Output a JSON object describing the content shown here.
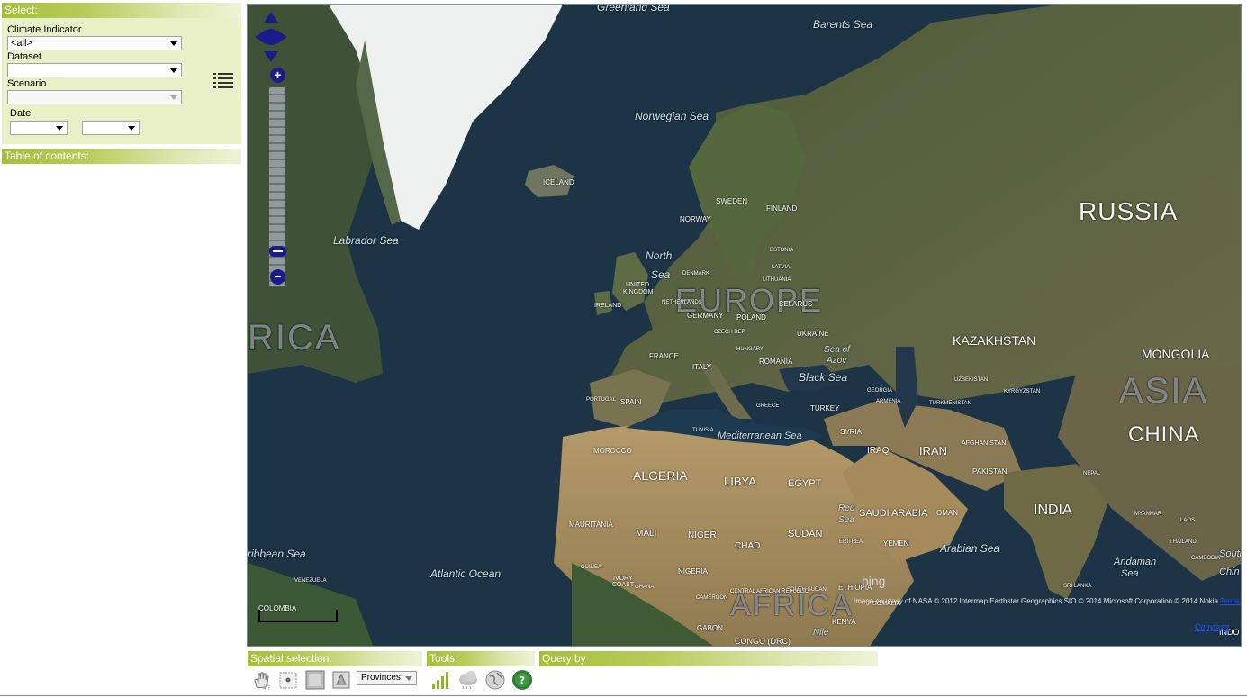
{
  "select_panel": {
    "title": "Select:",
    "climate_indicator_label": "Climate Indicator",
    "climate_indicator_value": "<all>",
    "dataset_label": "Dataset",
    "dataset_value": "",
    "scenario_label": "Scenario",
    "scenario_value": "",
    "date_label": "Date",
    "date_from_value": "",
    "date_to_value": ""
  },
  "toc": {
    "title": "Table of contents:"
  },
  "map": {
    "labels": {
      "greenland_sea": "Greenland Sea",
      "barents_sea": "Barents Sea",
      "norwegian_sea": "Norwegian Sea",
      "iceland": "ICELAND",
      "labrador_sea": "Labrador Sea",
      "north_sea_1": "North",
      "north_sea_2": "Sea",
      "sweden": "SWEDEN",
      "finland": "FINLAND",
      "norway": "NORWAY",
      "denmark": "DENMARK",
      "united_kingdom_1": "UNITED",
      "united_kingdom_2": "KINGDOM",
      "ireland": "IRELAND",
      "europe": "EUROPE",
      "germany": "GERMANY",
      "poland": "POLAND",
      "belarus": "BELARUS",
      "ukraine": "UKRAINE",
      "france": "FRANCE",
      "italy": "ITALY",
      "romania": "ROMANIA",
      "sea_of_azov_1": "Sea of",
      "sea_of_azov_2": "Azov",
      "black_sea": "Black Sea",
      "portugal": "PORTUGAL",
      "spain": "SPAIN",
      "greece": "GREECE",
      "turkey": "TURKEY",
      "russia": "RUSSIA",
      "kazakhstan": "KAZAKHSTAN",
      "mongolia": "MONGOLIA",
      "asia": "ASIA",
      "china": "CHINA",
      "uzbekistan": "UZBEKISTAN",
      "turkmenistan": "TURKMENISTAN",
      "kyrgyzstan": "KYRGYZSTAN",
      "mediterranean_sea": "Mediterranean Sea",
      "tunisia": "TUNISIA",
      "morocco": "MOROCCO",
      "algeria": "ALGERIA",
      "libya": "LIBYA",
      "egypt": "EGYPT",
      "syria": "SYRIA",
      "iraq": "IRAQ",
      "iran": "IRAN",
      "afghanistan": "AFGHANISTAN",
      "pakistan": "PAKISTAN",
      "nepal": "NEPAL",
      "india": "INDIA",
      "saudi_arabia": "SAUDI ARABIA",
      "oman": "OMAN",
      "red_sea_1": "Red",
      "red_sea_2": "Sea",
      "yemen": "YEMEN",
      "arabian_sea": "Arabian Sea",
      "mauritania": "MAURITANIA",
      "mali": "MALI",
      "niger": "NIGER",
      "chad": "CHAD",
      "sudan": "SUDAN",
      "eritrea": "ERITREA",
      "ethiopia": "ETHIOPIA",
      "somalia": "SOMALIA",
      "kenya": "KENYA",
      "nigeria": "NIGERIA",
      "guinea": "GUINEA",
      "ivory_coast_1": "IVORY",
      "ivory_coast_2": "COAST",
      "ghana": "GHANA",
      "cameroon": "CAMEROON",
      "central_african_republic": "CENTRAL AFRICAN REPUBLIC",
      "south_sudan": "SOUTH SUDAN",
      "gabon": "GABON",
      "congo": "CONGO (DRC)",
      "africa": "AFRICA",
      "atlantic_ocean": "Atlantic Ocean",
      "caribbean_sea": "ribbean Sea",
      "venezuela": "VENEZUELA",
      "colombia": "COLOMBIA",
      "rica": "RICA",
      "nile": "Nile",
      "myanmar": "MYANMAR",
      "thailand": "THAILAND",
      "laos": "LAOS",
      "cambodia": "CAMBODIA",
      "sri_lanka": "SRI LANKA",
      "andaman_sea_1": "Andaman",
      "andaman_sea_2": "Sea",
      "south_china_1": "South",
      "south_china_2": "Chin",
      "indo": "INDO",
      "sverige_small": "LATVIA",
      "lithuania": "LITHUANIA",
      "estonia": "ESTONIA",
      "netherlands": "NETHERLANDS",
      "hungary": "HUNGARY",
      "czech": "CZECH REP.",
      "georgia": "GEORGIA",
      "armenia": "ARMENIA"
    },
    "bing_logo": "bing",
    "attribution": "Image courtesy of NASA © 2012 Intermap Earthstar Geographics SIO © 2014 Microsoft Corporation © 2014 Nokia",
    "terms_link": "Terms of Use",
    "copyright_link": "Copyright"
  },
  "bottom": {
    "spatial_title": "Spatial selection:",
    "tools_title": "Tools:",
    "query_title": "Query by",
    "provinces_value": "Provinces"
  },
  "colors": {
    "header_green": "#a5bf3a",
    "panel_bg": "#e9efc6",
    "nav_blue": "#1b1b8a",
    "ocean": "#1c3446"
  }
}
